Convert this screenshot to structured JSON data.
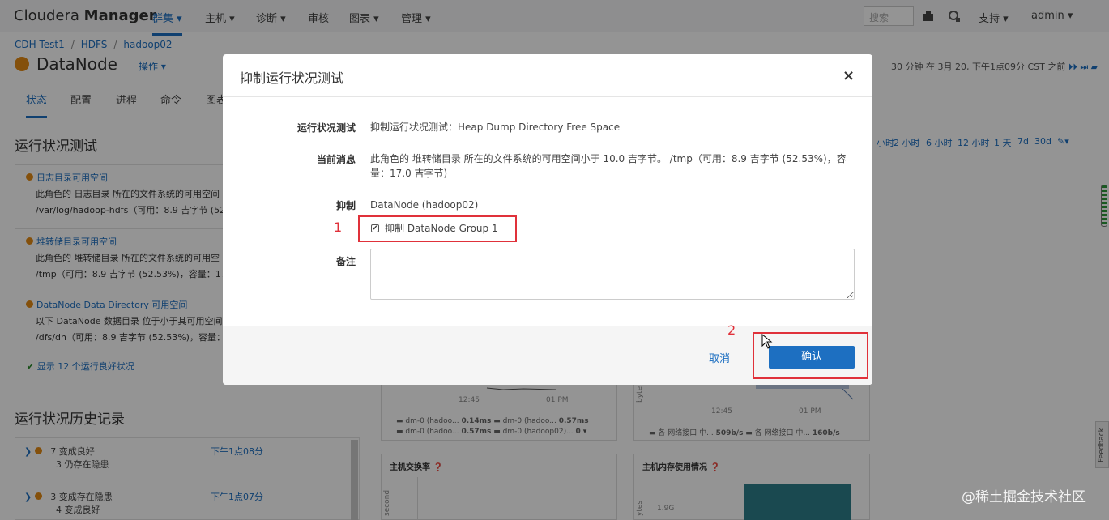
{
  "app": {
    "brand_light": "Cloudera",
    "brand_bold": "Manager"
  },
  "nav": {
    "items": [
      "群集 ▾",
      "主机 ▾",
      "诊断 ▾",
      "审核",
      "图表 ▾",
      "管理 ▾"
    ],
    "search_placeholder": "搜索",
    "support": "支持 ▾",
    "user": "admin ▾"
  },
  "breadcrumb": [
    "CDH Test1",
    "HDFS",
    "hadoop02"
  ],
  "page": {
    "title": "DataNode",
    "actions": "操作 ▾",
    "time_info": "30 分钟 在 3月 20, 下午1点09分 CST 之前"
  },
  "tabs": [
    "状态",
    "配置",
    "进程",
    "命令",
    "图表"
  ],
  "health": {
    "heading": "运行状况测试",
    "alerts": [
      {
        "title": "日志目录可用空间",
        "line1": "此角色的 日志目录 所在的文件系统的可用空间",
        "line2": "/var/log/hadoop-hdfs（可用：8.9 吉字节 (52"
      },
      {
        "title": "堆转储目录可用空间",
        "line1": "此角色的 堆转储目录 所在的文件系统的可用空",
        "line2": "/tmp（可用：8.9 吉字节 (52.53%)，容量：17"
      },
      {
        "title": "DataNode Data Directory 可用空间",
        "line1": "以下 DataNode 数据目录 位于小于其可用空间",
        "line2": "/dfs/dn（可用：8.9 吉字节 (52.53%)，容量："
      }
    ],
    "ok_link": "显示 12 个运行良好状况"
  },
  "history": {
    "heading": "运行状况历史记录",
    "rows": [
      {
        "line1": "7 变成良好",
        "line2": "3 仍存在隐患",
        "time": "下午1点08分"
      },
      {
        "line1": "3 变成存在隐患",
        "line2": "4 变成良好",
        "time": "下午1点07分"
      }
    ]
  },
  "time_ranges": [
    "小时",
    "2 小时",
    "6 小时",
    "12 小时",
    "1 天",
    "7d",
    "30d"
  ],
  "charts": {
    "card1": {
      "ticks": [
        "12:45",
        "01 PM"
      ],
      "legend": [
        "dm-0 (hadoo...",
        "0.14ms",
        "dm-0 (hadoo...",
        "0.57ms",
        "dm-0 (hadoo...",
        "0.57ms",
        "dm-0 (hadoop02)...",
        "0"
      ]
    },
    "card2": {
      "ticks": [
        "12:45",
        "01 PM"
      ],
      "legend": [
        "各 网络接口 中...",
        "509b/s",
        "各 网络接口 中...",
        "160b/s"
      ],
      "ylabel": "byte"
    },
    "card3": {
      "title": "主机交换率",
      "ylabel": "second"
    },
    "card4": {
      "title": "主机内存使用情况",
      "ylabel": "ytes",
      "tick": "1.9G"
    }
  },
  "modal": {
    "title": "抑制运行状况测试",
    "close": "×",
    "label_test": "运行状况测试",
    "value_test": "抑制运行状况测试：Heap Dump Directory Free Space",
    "label_message": "当前消息",
    "value_message_1": "此角色的 堆转储目录 所在的文件系统的可用空间小于 10.0 吉字节。 /tmp（可用：8.9 吉字节 (52.53%)，容",
    "value_message_2": "量：17.0 吉字节)",
    "label_suppress": "抑制",
    "value_suppress": "DataNode (hadoop02)",
    "checkbox_label": "抑制 DataNode Group 1",
    "checkbox_checked": true,
    "label_notes": "备注",
    "notes_value": "",
    "cancel": "取消",
    "confirm": "确认"
  },
  "annotations": {
    "step1": "1",
    "step2": "2"
  },
  "feedback": "Feedback",
  "watermark": "@稀土掘金技术社区",
  "colors": {
    "accent": "#1d6fc1",
    "warning": "#e48a14",
    "highlight": "#e0313a",
    "chart_fill": "#2d7f8a"
  }
}
